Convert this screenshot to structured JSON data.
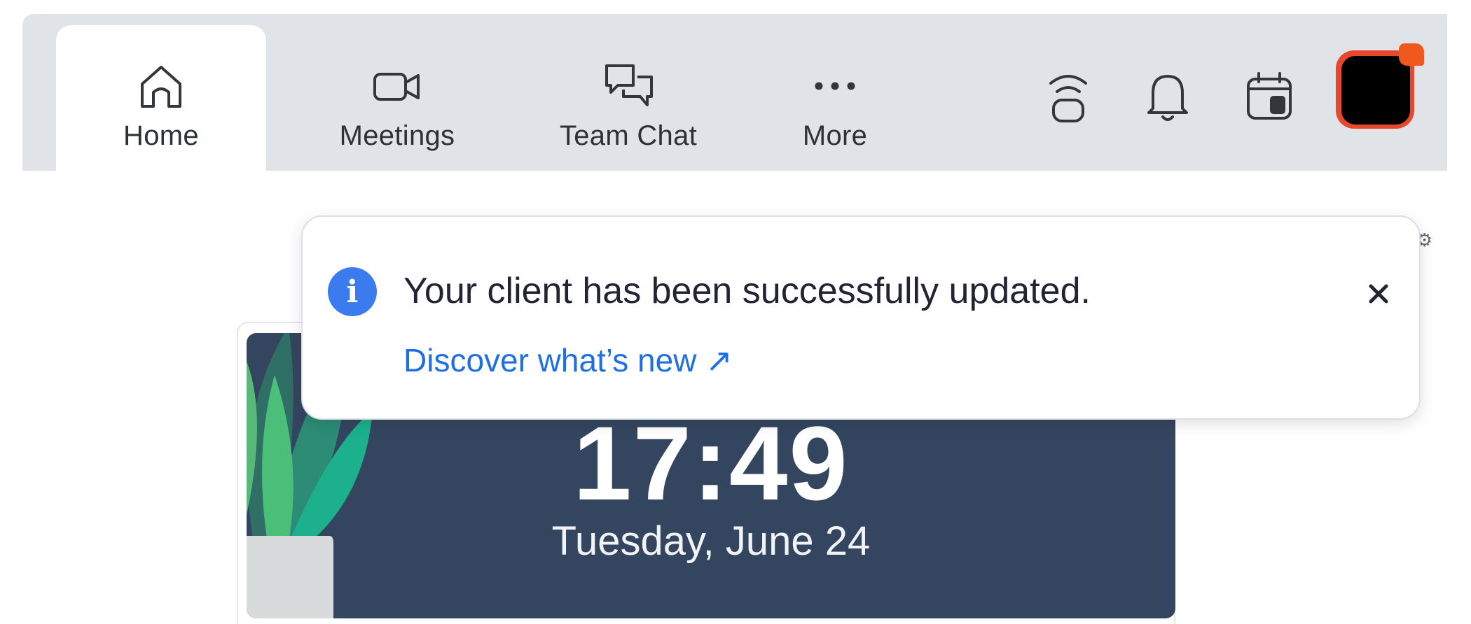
{
  "nav": {
    "tabs": [
      {
        "label": "Home",
        "icon": "home-icon",
        "active": true
      },
      {
        "label": "Meetings",
        "icon": "video-camera-icon",
        "active": false
      },
      {
        "label": "Team Chat",
        "icon": "chat-bubbles-icon",
        "active": false
      },
      {
        "label": "More",
        "icon": "ellipsis-icon",
        "active": false
      }
    ],
    "right_icons": [
      "wireless-broadcast-icon",
      "bell-icon",
      "calendar-icon"
    ],
    "avatar": {
      "status_color": "#f0591e"
    }
  },
  "clock_card": {
    "time": "17:49",
    "date": "Tuesday, June 24"
  },
  "notification": {
    "icon": "info-icon",
    "message": "Your client has been successfully updated.",
    "link_text": "Discover what’s new ↗",
    "close_icon": "close-icon"
  },
  "colors": {
    "topbar_bg": "#e0e3e8",
    "accent_blue": "#1f6fe3",
    "info_blue": "#3a7bf0",
    "card_bg": "#34465f",
    "avatar_ring": "#e7472a"
  }
}
